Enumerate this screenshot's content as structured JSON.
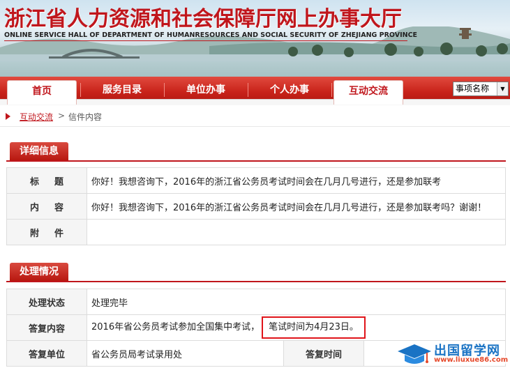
{
  "banner": {
    "title_cn": "浙江省人力资源和社会保障厅网上办事大厅",
    "title_en": "ONLINE SERVICE HALL OF DEPARTMENT OF HUMANRESOURCES AND SOCIAL SECURITY OF ZHEJIANG PROVINCE"
  },
  "nav": {
    "items": [
      "首页",
      "服务目录",
      "单位办事",
      "个人办事",
      "互动交流"
    ],
    "search_select": "事项名称"
  },
  "breadcrumb": {
    "link": "互动交流",
    "separator": ">",
    "current": "信件内容"
  },
  "detail": {
    "heading": "详细信息",
    "rows": [
      {
        "label": "标题",
        "value": "你好！我想咨询下，2016年的浙江省公务员考试时间会在几月几号进行，还是参加联考"
      },
      {
        "label": "内容",
        "value": "你好！我想咨询下，2016年的浙江省公务员考试时间会在几月几号进行，还是参加联考吗？谢谢！"
      },
      {
        "label": "附件",
        "value": ""
      }
    ]
  },
  "processing": {
    "heading": "处理情况",
    "status_label": "处理状态",
    "status_value": "处理完毕",
    "reply_label": "答复内容",
    "reply_value_a": "2016年省公务员考试参加全国集中考试，",
    "reply_value_b": "笔试时间为4月23日。",
    "unit_label": "答复单位",
    "unit_value": "省公务员局考试录用处",
    "time_label": "答复时间",
    "time_value": ""
  },
  "watermark": {
    "name": "出国留学网",
    "url": "www.liuxue86.com"
  },
  "colors": {
    "brand_red": "#c0161c",
    "highlight_border": "#e0141a"
  }
}
